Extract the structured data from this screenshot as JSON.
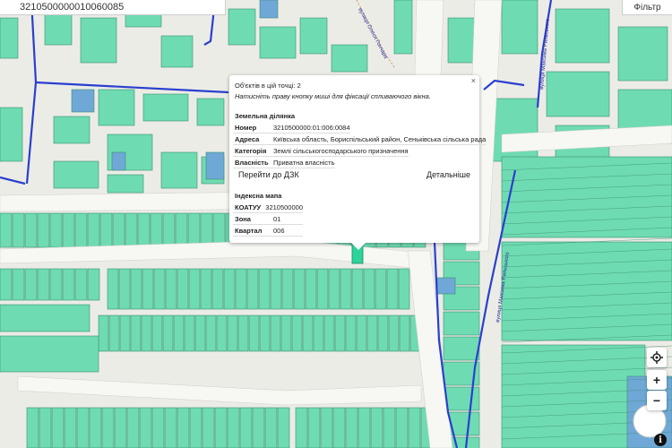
{
  "search": {
    "value": "3210500000010060085"
  },
  "filter": {
    "label": "Фільтр"
  },
  "streets": {
    "a": "вулиця Олеся Гончара",
    "b": "вулиця Максима Рильського",
    "c": "вулиця Максима Рильського"
  },
  "popup": {
    "count_text": "Об'єктів в цій точці: 2",
    "hint_text": "Натисніть праву кнопку миші для фіксації спливаючого вікна.",
    "close": "×",
    "parcel": {
      "heading": "Земельна ділянка",
      "rows": [
        {
          "key": "Номер",
          "value": "3210500000:01:006:0084"
        },
        {
          "key": "Адреса",
          "value": "Київська область, Бориспільський район, Сеньківська сільська рада"
        },
        {
          "key": "Категорія",
          "value": "Землі сільськогосподарського призначення"
        },
        {
          "key": "Власність",
          "value": "Приватна власність"
        }
      ],
      "link_dzk": "Перейти до ДЗК",
      "link_details": "Детальніше"
    },
    "index_map": {
      "heading": "Індексна мапа",
      "rows": [
        {
          "key": "КОАТУУ",
          "value": "3210500000"
        },
        {
          "key": "Зона",
          "value": "01"
        },
        {
          "key": "Квартал",
          "value": "006"
        }
      ]
    }
  },
  "controls": {
    "locate_icon": "crosshair-icon",
    "zoom_in": "+",
    "zoom_out": "−",
    "info": "i"
  },
  "colors": {
    "parcel_fill": "#6fdbb2",
    "parcel_stroke": "#3a8f72",
    "highlight_parcel": "#2dd39a",
    "blue_parcel": "#6fa8d6",
    "road": "#ffffff",
    "boundary": "#2a3fcf",
    "background": "#ecece6"
  }
}
